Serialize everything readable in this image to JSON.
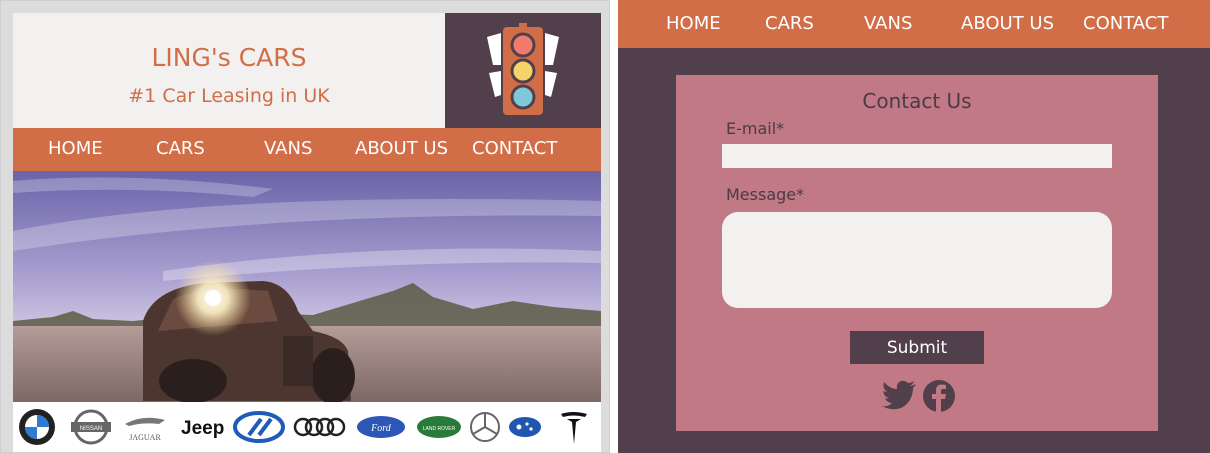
{
  "left": {
    "brand_title": "LING's CARS",
    "brand_subtitle": "#1 Car Leasing in UK",
    "logo_icon": "traffic-light-icon",
    "nav": [
      {
        "label": "HOME"
      },
      {
        "label": "CARS"
      },
      {
        "label": "VANS"
      },
      {
        "label": "ABOUT US"
      },
      {
        "label": "CONTACT"
      }
    ],
    "brand_logos": [
      {
        "name": "bmw",
        "text": ""
      },
      {
        "name": "nissan",
        "text": "NISSAN"
      },
      {
        "name": "jaguar",
        "text": "JAGUAR"
      },
      {
        "name": "jeep",
        "text": "Jeep"
      },
      {
        "name": "hyundai",
        "text": ""
      },
      {
        "name": "audi",
        "text": ""
      },
      {
        "name": "ford",
        "text": "Ford"
      },
      {
        "name": "land-rover",
        "text": "LAND ROVER"
      },
      {
        "name": "mercedes",
        "text": ""
      },
      {
        "name": "subaru",
        "text": ""
      },
      {
        "name": "tesla",
        "text": ""
      }
    ]
  },
  "right": {
    "nav": [
      {
        "label": "HOME"
      },
      {
        "label": "CARS"
      },
      {
        "label": "VANS"
      },
      {
        "label": "ABOUT US"
      },
      {
        "label": "CONTACT"
      }
    ],
    "form": {
      "title": "Contact Us",
      "email_label": "E-mail*",
      "email_value": "",
      "message_label": "Message*",
      "message_value": "",
      "submit_label": "Submit"
    },
    "social": [
      {
        "name": "twitter-icon"
      },
      {
        "name": "facebook-icon"
      }
    ]
  },
  "colors": {
    "accent": "#d26e47",
    "dark": "#51404b",
    "card": "#c07985",
    "light": "#f2f1ef"
  }
}
